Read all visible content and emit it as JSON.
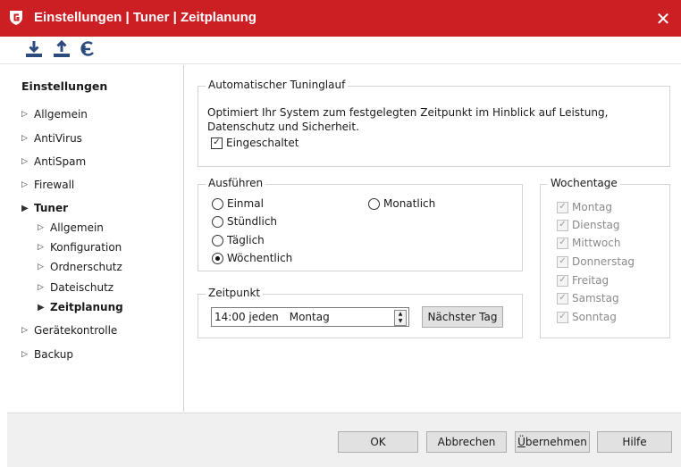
{
  "window": {
    "title": "Einstellungen | Tuner | Zeitplanung",
    "close_glyph": "✕",
    "accent": "#cc1f24"
  },
  "toolbar": {
    "icons": [
      "download-icon",
      "upload-icon",
      "reset-icon"
    ]
  },
  "sidebar": {
    "title": "Einstellungen",
    "items": [
      {
        "label": "Allgemein"
      },
      {
        "label": "AntiVirus"
      },
      {
        "label": "AntiSpam"
      },
      {
        "label": "Firewall"
      },
      {
        "label": "Tuner"
      },
      {
        "label": "Allgemein"
      },
      {
        "label": "Konfiguration"
      },
      {
        "label": "Ordnerschutz"
      },
      {
        "label": "Dateischutz"
      },
      {
        "label": "Zeitplanung"
      },
      {
        "label": "Gerätekontrolle"
      },
      {
        "label": "Backup"
      }
    ]
  },
  "auto": {
    "legend": "Automatischer Tuninglauf",
    "description": "Optimiert Ihr System zum festgelegten Zeitpunkt im Hinblick auf Leistung, Datenschutz und Sicherheit.",
    "enabled_label": "Eingeschaltet",
    "enabled": true
  },
  "ausfuehren": {
    "legend": "Ausführen",
    "options": [
      "Einmal",
      "Stündlich",
      "Täglich",
      "Wöchentlich",
      "Monatlich"
    ],
    "selected": "Wöchentlich"
  },
  "zeitpunkt": {
    "legend": "Zeitpunkt",
    "time": "14:00 jeden",
    "day": "Montag",
    "next_day_button": "Nächster Tag"
  },
  "wochentage": {
    "legend": "Wochentage",
    "days": [
      "Montag",
      "Dienstag",
      "Mittwoch",
      "Donnerstag",
      "Freitag",
      "Samstag",
      "Sonntag"
    ],
    "checked": [
      true,
      true,
      true,
      true,
      true,
      true,
      true
    ]
  },
  "footer": {
    "ok": "OK",
    "cancel": "Abbrechen",
    "apply_underlined": "Ü",
    "apply_rest": "bernehmen",
    "help": "Hilfe"
  }
}
